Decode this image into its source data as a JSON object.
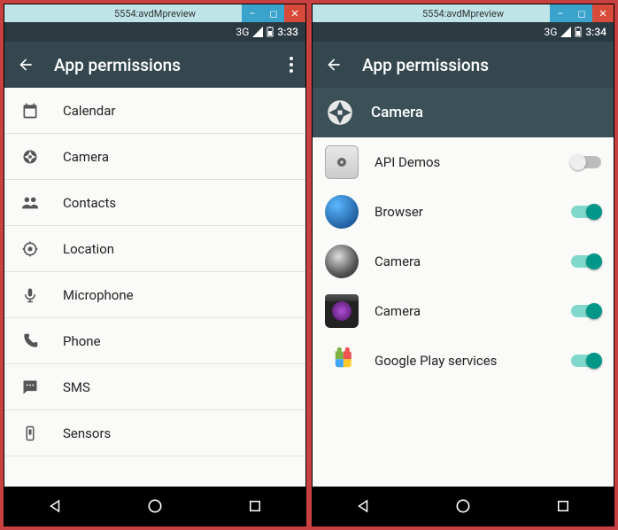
{
  "left": {
    "window_title": "5554:avdMpreview",
    "status": {
      "network": "3G",
      "battery": "▾",
      "time": "3:33"
    },
    "appbar": {
      "title": "App permissions"
    },
    "permissions": [
      {
        "icon": "calendar-icon",
        "label": "Calendar"
      },
      {
        "icon": "camera-aperture-icon",
        "label": "Camera"
      },
      {
        "icon": "contacts-icon",
        "label": "Contacts"
      },
      {
        "icon": "location-icon",
        "label": "Location"
      },
      {
        "icon": "microphone-icon",
        "label": "Microphone"
      },
      {
        "icon": "phone-icon",
        "label": "Phone"
      },
      {
        "icon": "sms-icon",
        "label": "SMS"
      },
      {
        "icon": "sensors-icon",
        "label": "Sensors"
      }
    ]
  },
  "right": {
    "window_title": "5554:avdMpreview",
    "status": {
      "network": "3G",
      "battery": "▾",
      "time": "3:34"
    },
    "appbar": {
      "title": "App permissions"
    },
    "subheader": {
      "icon": "camera-aperture-icon",
      "label": "Camera"
    },
    "apps": [
      {
        "icon": "folder-gear",
        "label": "API Demos",
        "enabled": false
      },
      {
        "icon": "globe",
        "label": "Browser",
        "enabled": true
      },
      {
        "icon": "lens",
        "label": "Camera",
        "enabled": true
      },
      {
        "icon": "camera-app",
        "label": "Camera",
        "enabled": true
      },
      {
        "icon": "play-services",
        "label": "Google Play services",
        "enabled": true
      }
    ]
  }
}
